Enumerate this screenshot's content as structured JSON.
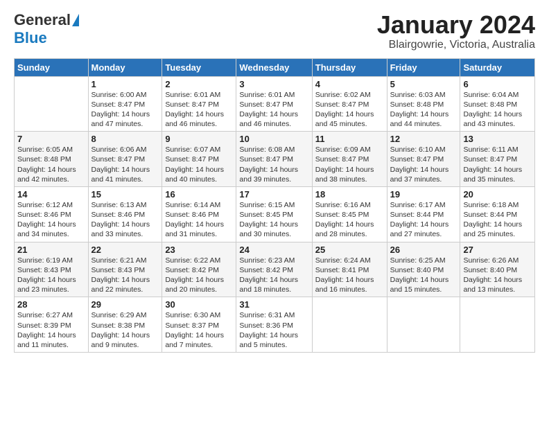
{
  "logo": {
    "general": "General",
    "blue": "Blue"
  },
  "title": "January 2024",
  "subtitle": "Blairgowrie, Victoria, Australia",
  "weekdays": [
    "Sunday",
    "Monday",
    "Tuesday",
    "Wednesday",
    "Thursday",
    "Friday",
    "Saturday"
  ],
  "weeks": [
    [
      {
        "day": "",
        "info": ""
      },
      {
        "day": "1",
        "info": "Sunrise: 6:00 AM\nSunset: 8:47 PM\nDaylight: 14 hours\nand 47 minutes."
      },
      {
        "day": "2",
        "info": "Sunrise: 6:01 AM\nSunset: 8:47 PM\nDaylight: 14 hours\nand 46 minutes."
      },
      {
        "day": "3",
        "info": "Sunrise: 6:01 AM\nSunset: 8:47 PM\nDaylight: 14 hours\nand 46 minutes."
      },
      {
        "day": "4",
        "info": "Sunrise: 6:02 AM\nSunset: 8:47 PM\nDaylight: 14 hours\nand 45 minutes."
      },
      {
        "day": "5",
        "info": "Sunrise: 6:03 AM\nSunset: 8:48 PM\nDaylight: 14 hours\nand 44 minutes."
      },
      {
        "day": "6",
        "info": "Sunrise: 6:04 AM\nSunset: 8:48 PM\nDaylight: 14 hours\nand 43 minutes."
      }
    ],
    [
      {
        "day": "7",
        "info": "Sunrise: 6:05 AM\nSunset: 8:48 PM\nDaylight: 14 hours\nand 42 minutes."
      },
      {
        "day": "8",
        "info": "Sunrise: 6:06 AM\nSunset: 8:47 PM\nDaylight: 14 hours\nand 41 minutes."
      },
      {
        "day": "9",
        "info": "Sunrise: 6:07 AM\nSunset: 8:47 PM\nDaylight: 14 hours\nand 40 minutes."
      },
      {
        "day": "10",
        "info": "Sunrise: 6:08 AM\nSunset: 8:47 PM\nDaylight: 14 hours\nand 39 minutes."
      },
      {
        "day": "11",
        "info": "Sunrise: 6:09 AM\nSunset: 8:47 PM\nDaylight: 14 hours\nand 38 minutes."
      },
      {
        "day": "12",
        "info": "Sunrise: 6:10 AM\nSunset: 8:47 PM\nDaylight: 14 hours\nand 37 minutes."
      },
      {
        "day": "13",
        "info": "Sunrise: 6:11 AM\nSunset: 8:47 PM\nDaylight: 14 hours\nand 35 minutes."
      }
    ],
    [
      {
        "day": "14",
        "info": "Sunrise: 6:12 AM\nSunset: 8:46 PM\nDaylight: 14 hours\nand 34 minutes."
      },
      {
        "day": "15",
        "info": "Sunrise: 6:13 AM\nSunset: 8:46 PM\nDaylight: 14 hours\nand 33 minutes."
      },
      {
        "day": "16",
        "info": "Sunrise: 6:14 AM\nSunset: 8:46 PM\nDaylight: 14 hours\nand 31 minutes."
      },
      {
        "day": "17",
        "info": "Sunrise: 6:15 AM\nSunset: 8:45 PM\nDaylight: 14 hours\nand 30 minutes."
      },
      {
        "day": "18",
        "info": "Sunrise: 6:16 AM\nSunset: 8:45 PM\nDaylight: 14 hours\nand 28 minutes."
      },
      {
        "day": "19",
        "info": "Sunrise: 6:17 AM\nSunset: 8:44 PM\nDaylight: 14 hours\nand 27 minutes."
      },
      {
        "day": "20",
        "info": "Sunrise: 6:18 AM\nSunset: 8:44 PM\nDaylight: 14 hours\nand 25 minutes."
      }
    ],
    [
      {
        "day": "21",
        "info": "Sunrise: 6:19 AM\nSunset: 8:43 PM\nDaylight: 14 hours\nand 23 minutes."
      },
      {
        "day": "22",
        "info": "Sunrise: 6:21 AM\nSunset: 8:43 PM\nDaylight: 14 hours\nand 22 minutes."
      },
      {
        "day": "23",
        "info": "Sunrise: 6:22 AM\nSunset: 8:42 PM\nDaylight: 14 hours\nand 20 minutes."
      },
      {
        "day": "24",
        "info": "Sunrise: 6:23 AM\nSunset: 8:42 PM\nDaylight: 14 hours\nand 18 minutes."
      },
      {
        "day": "25",
        "info": "Sunrise: 6:24 AM\nSunset: 8:41 PM\nDaylight: 14 hours\nand 16 minutes."
      },
      {
        "day": "26",
        "info": "Sunrise: 6:25 AM\nSunset: 8:40 PM\nDaylight: 14 hours\nand 15 minutes."
      },
      {
        "day": "27",
        "info": "Sunrise: 6:26 AM\nSunset: 8:40 PM\nDaylight: 14 hours\nand 13 minutes."
      }
    ],
    [
      {
        "day": "28",
        "info": "Sunrise: 6:27 AM\nSunset: 8:39 PM\nDaylight: 14 hours\nand 11 minutes."
      },
      {
        "day": "29",
        "info": "Sunrise: 6:29 AM\nSunset: 8:38 PM\nDaylight: 14 hours\nand 9 minutes."
      },
      {
        "day": "30",
        "info": "Sunrise: 6:30 AM\nSunset: 8:37 PM\nDaylight: 14 hours\nand 7 minutes."
      },
      {
        "day": "31",
        "info": "Sunrise: 6:31 AM\nSunset: 8:36 PM\nDaylight: 14 hours\nand 5 minutes."
      },
      {
        "day": "",
        "info": ""
      },
      {
        "day": "",
        "info": ""
      },
      {
        "day": "",
        "info": ""
      }
    ]
  ]
}
